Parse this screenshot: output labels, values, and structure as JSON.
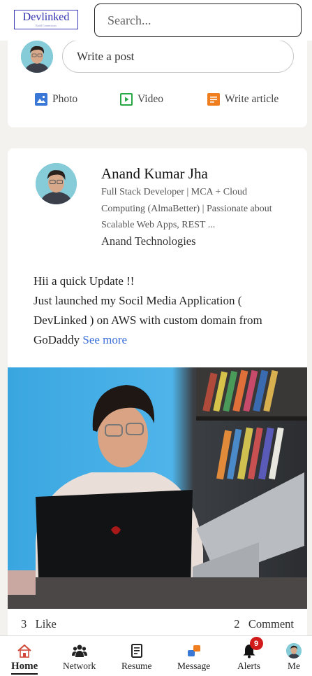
{
  "header": {
    "logo_text": "Devlinked",
    "logo_tagline": "Build Connections",
    "search_placeholder": "Search..."
  },
  "composer": {
    "placeholder": "Write a post",
    "actions": [
      {
        "label": "Photo",
        "icon": "photo-icon",
        "color": "#3a78d8"
      },
      {
        "label": "Video",
        "icon": "video-icon",
        "color": "#27a844"
      },
      {
        "label": "Write article",
        "icon": "article-icon",
        "color": "#f07d1e"
      }
    ]
  },
  "post": {
    "author": {
      "name": "Anand Kumar Jha",
      "headline": "Full Stack Developer | MCA + Cloud Computing (AlmaBetter) | Passionate about Scalable Web Apps, REST  ...",
      "company": "Anand Technologies"
    },
    "text_line1": "Hii a quick Update !!",
    "text_line2": "Just launched my Socil Media Application ( DevLinked ) on AWS with custom domain from GoDaddy",
    "see_more": "See more",
    "likes_count": "3",
    "likes_label": "Like",
    "comments_count": "2",
    "comments_label": "Comment"
  },
  "bottom_nav": {
    "items": [
      {
        "label": "Home",
        "icon": "home-icon",
        "active": true
      },
      {
        "label": "Network",
        "icon": "network-icon"
      },
      {
        "label": "Resume",
        "icon": "resume-icon"
      },
      {
        "label": "Message",
        "icon": "message-icon"
      },
      {
        "label": "Alerts",
        "icon": "bell-icon",
        "badge": "9"
      },
      {
        "label": "Me",
        "icon": "avatar"
      }
    ]
  },
  "colors": {
    "accent": "#3a6fd8",
    "badge": "#d11a1a",
    "logo": "#3030b0"
  }
}
